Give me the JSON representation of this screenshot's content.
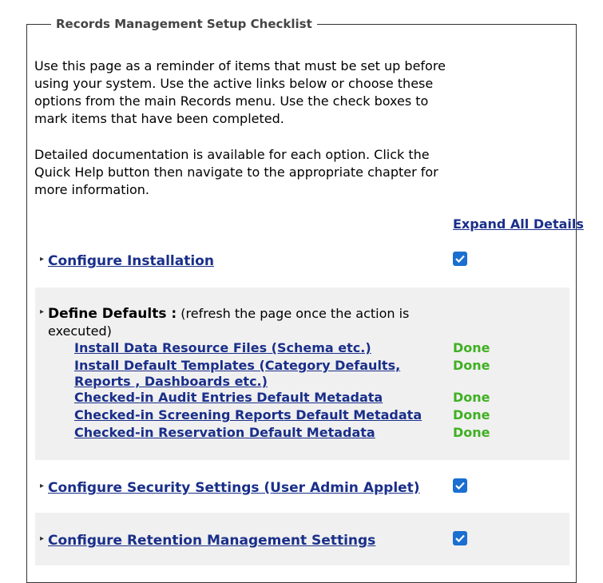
{
  "legend": "Records Management Setup Checklist",
  "intro": {
    "paragraph1": "Use this page as a reminder of items that must be set up before using your system. Use the active links below or choose these options from the main Records menu. Use the check boxes to mark items that have been completed.",
    "paragraph2": "Detailed documentation is available for each option. Click the Quick Help button then navigate to the appropriate chapter for more information."
  },
  "expand_all_label": "Expand All Details",
  "sections": {
    "configure_installation": {
      "label": "Configure Installation",
      "checked": true
    },
    "define_defaults": {
      "label": "Define Defaults :",
      "note": "(refresh the page once the action is executed)",
      "items": [
        {
          "label": "Install Data Resource Files (Schema etc.)",
          "status": "Done"
        },
        {
          "label": "Install Default Templates (Category Defaults, Reports , Dashboards etc.)",
          "status": "Done"
        },
        {
          "label": "Checked-in Audit Entries Default Metadata",
          "status": "Done"
        },
        {
          "label": "Checked-in Screening Reports Default Metadata",
          "status": "Done"
        },
        {
          "label": "Checked-in Reservation Default Metadata",
          "status": "Done"
        }
      ]
    },
    "security_settings": {
      "label": "Configure Security Settings (User Admin Applet)",
      "checked": true
    },
    "retention_settings": {
      "label": "Configure Retention Management Settings",
      "checked": true
    }
  },
  "colors": {
    "link": "#1a2f8a",
    "done": "#3fb023",
    "checkbox": "#1a6fd0",
    "shaded": "#f0f0f0"
  },
  "icons": {
    "expand": "chevron-right-icon",
    "checkbox": "checkbox-checked-icon"
  }
}
